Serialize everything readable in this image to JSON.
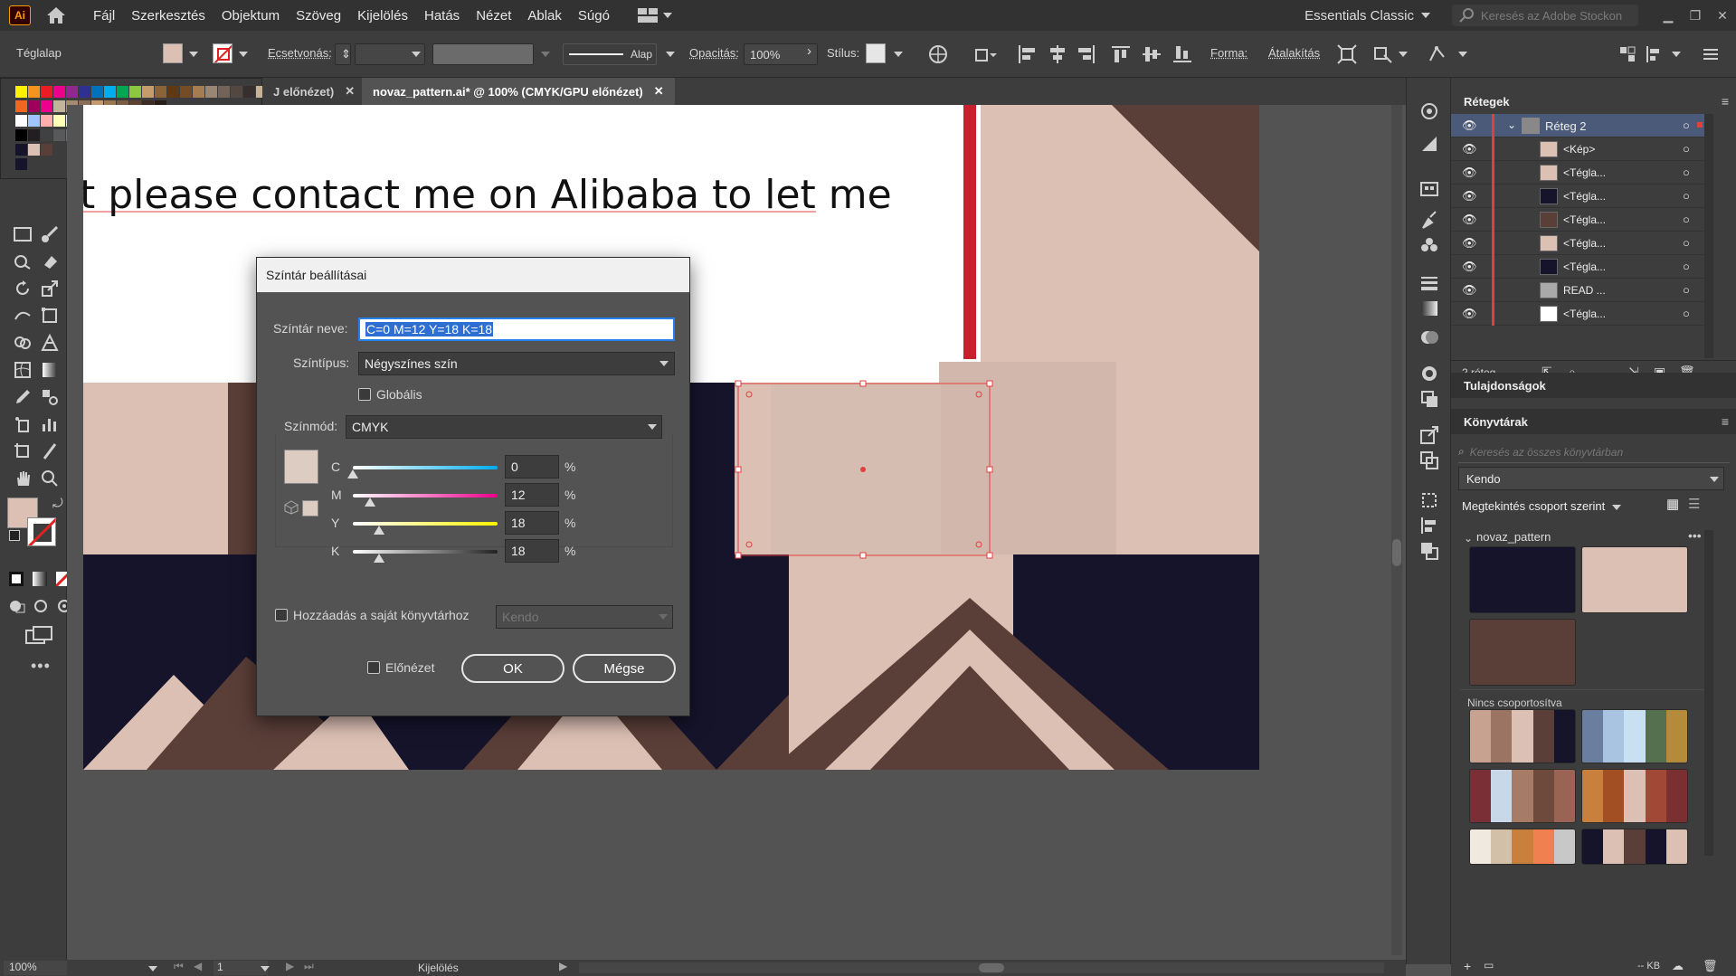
{
  "app": {
    "logo_text": "Ai",
    "menu": [
      "Fájl",
      "Szerkesztés",
      "Objektum",
      "Szöveg",
      "Kijelölés",
      "Hatás",
      "Nézet",
      "Ablak",
      "Súgó"
    ],
    "workspace": "Essentials Classic",
    "stock_search_placeholder": "Keresés az Adobe Stockon"
  },
  "control_bar": {
    "object_label": "Téglalap",
    "stroke_label": "Ecsetvonás:",
    "stroke_profile": "Alap",
    "opacity_label": "Opacitás:",
    "opacity_value": "100%",
    "style_label": "Stílus:",
    "shape_label": "Forma:",
    "transform_label": "Átalakítás",
    "fill_color": "#dcc0b4"
  },
  "tabs": [
    {
      "label": "J előnézet)",
      "active": false
    },
    {
      "label": "novaz_pattern.ai* @ 100% (CMYK/GPU előnézet)",
      "active": true
    }
  ],
  "artboard": {
    "text_line": "t please contact me on Alibaba to let me"
  },
  "dialog": {
    "title": "Színtár beállításai",
    "name_label": "Színtár neve:",
    "name_value": "C=0 M=12 Y=18 K=18",
    "type_label": "Színtípus:",
    "type_value": "Négyszínes szín",
    "global_label": "Globális",
    "mode_label": "Színmód:",
    "mode_value": "CMYK",
    "channels": [
      {
        "letter": "C",
        "value": "0",
        "unit": "%",
        "fraction": 0.0
      },
      {
        "letter": "M",
        "value": "12",
        "unit": "%",
        "fraction": 0.12
      },
      {
        "letter": "Y",
        "value": "18",
        "unit": "%",
        "fraction": 0.18
      },
      {
        "letter": "K",
        "value": "18",
        "unit": "%",
        "fraction": 0.18
      }
    ],
    "add_to_library_label": "Hozzáadás a saját könyvtárhoz",
    "library_value": "Kendo",
    "preview_label": "Előnézet",
    "ok_label": "OK",
    "cancel_label": "Mégse",
    "swatch_color": "#dcccc2"
  },
  "layers_panel": {
    "title": "Rétegek",
    "top_layer": "Réteg 2",
    "items": [
      "<Kép>",
      "<Tégla...",
      "<Tégla...",
      "<Tégla...",
      "<Tégla...",
      "<Tégla...",
      "READ ...",
      "<Tégla..."
    ],
    "footer_count": "2 réteg"
  },
  "properties_panel": {
    "title": "Tulajdonságok"
  },
  "libraries_panel": {
    "title": "Könyvtárak",
    "search_placeholder": "Keresés az összes könyvtárban",
    "library_name": "Kendo",
    "view_label": "Megtekintés csoport szerint",
    "group_name": "novaz_pattern",
    "ungrouped_label": "Nincs csoportosítva",
    "footer_size": "-- KB"
  },
  "status_bar": {
    "zoom": "100%",
    "artboard_num": "1",
    "mode": "Kijelölés"
  }
}
